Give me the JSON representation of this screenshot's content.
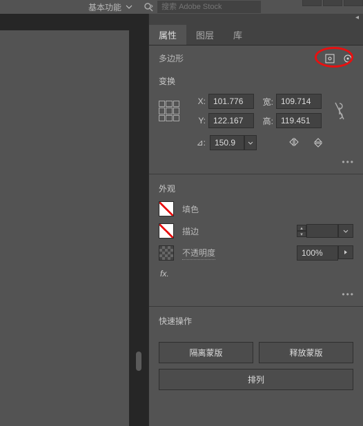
{
  "topbar": {
    "workspace_label": "基本功能",
    "search_placeholder": "搜索 Adobe Stock"
  },
  "tabs": {
    "properties": "属性",
    "layers": "图层",
    "libraries": "库"
  },
  "shape_header": {
    "title": "多边形"
  },
  "transform": {
    "title": "变换",
    "x_label": "X:",
    "x_value": "101.776",
    "y_label": "Y:",
    "y_value": "122.167",
    "w_label": "宽:",
    "w_value": "109.714",
    "h_label": "高:",
    "h_value": "119.451",
    "angle_label": "⊿:",
    "angle_value": "150.9"
  },
  "appearance": {
    "title": "外观",
    "fill_label": "填色",
    "stroke_label": "描边",
    "opacity_label": "不透明度",
    "opacity_value": "100%",
    "fx_label": "fx."
  },
  "quick": {
    "title": "快速操作",
    "isolate": "隔离蒙版",
    "release": "释放蒙版",
    "arrange": "排列"
  },
  "more_dots": "•••"
}
